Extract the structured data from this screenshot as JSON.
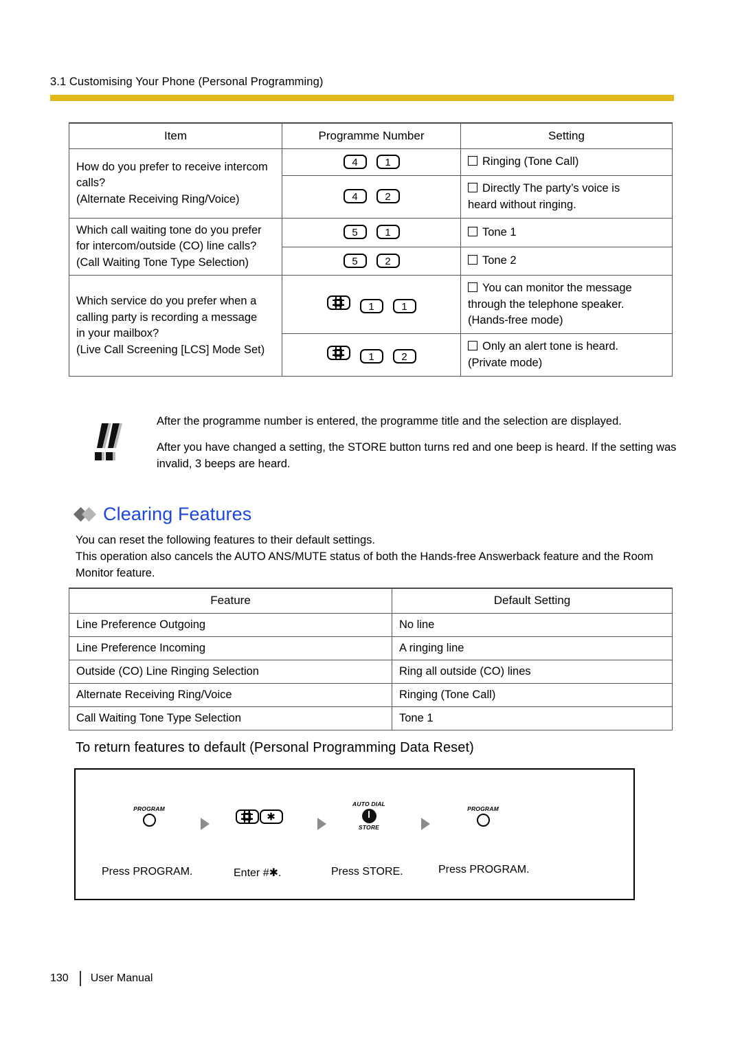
{
  "running_head": "3.1 Customising Your Phone (Personal Programming)",
  "rule_color": "#e0b81a",
  "programme_table": {
    "headers": [
      "Item",
      "Programme Number",
      "Setting"
    ],
    "groups": [
      {
        "item_lines": [
          "How do you prefer to receive intercom",
          "calls?",
          "(Alternate Receiving Ring/Voice)"
        ],
        "rows": [
          {
            "keys": [
              "4",
              "1"
            ],
            "setting_lines": [
              "Ringing (Tone Call)"
            ]
          },
          {
            "keys": [
              "4",
              "2"
            ],
            "setting_lines": [
              "Directly The party’s voice is",
              "heard without ringing."
            ]
          }
        ]
      },
      {
        "item_lines": [
          "Which call waiting tone do you prefer",
          "for intercom/outside (CO) line calls?",
          "(Call Waiting Tone Type Selection)"
        ],
        "rows": [
          {
            "keys": [
              "5",
              "1"
            ],
            "setting_lines": [
              "Tone 1"
            ]
          },
          {
            "keys": [
              "5",
              "2"
            ],
            "setting_lines": [
              "Tone 2"
            ]
          }
        ]
      },
      {
        "item_lines": [
          "Which service do you prefer when a",
          "calling party is recording a message",
          "in your mailbox?",
          "(Live Call Screening [LCS] Mode Set)"
        ],
        "rows": [
          {
            "keys": [
              "#",
              "1",
              "1"
            ],
            "setting_lines": [
              "You can monitor the message",
              "through the telephone speaker.",
              "(Hands-free mode)"
            ]
          },
          {
            "keys": [
              "#",
              "1",
              "2"
            ],
            "setting_lines": [
              "Only an alert tone is heard.",
              "(Private mode)"
            ]
          }
        ]
      }
    ]
  },
  "note": {
    "icon": "double-exclamation-icon",
    "paragraphs": [
      "After the programme number is entered, the programme title and the selection are displayed.",
      "After you have changed a setting, the STORE button turns red and one beep is heard. If the setting was invalid, 3 beeps are heard."
    ]
  },
  "section": {
    "heading": "Clearing Features",
    "heading_color": "#1b47e0",
    "paragraphs": [
      "You can reset the following features to their default settings.",
      "This operation also cancels the AUTO ANS/MUTE status of both the Hands-free Answerback feature and the Room Monitor feature."
    ]
  },
  "defaults_table": {
    "headers": [
      "Feature",
      "Default Setting"
    ],
    "rows": [
      [
        "Line Preference Outgoing",
        "No line"
      ],
      [
        "Line Preference Incoming",
        "A ringing line"
      ],
      [
        "Outside (CO) Line Ringing Selection",
        "Ring all outside (CO) lines"
      ],
      [
        "Alternate Receiving Ring/Voice",
        "Ringing (Tone Call)"
      ],
      [
        "Call Waiting Tone Type Selection",
        "Tone 1"
      ]
    ]
  },
  "procedure": {
    "title": "To return features to default (Personal Programming Data Reset)",
    "steps": [
      {
        "button_top": "PROGRAM",
        "button_bottom": "",
        "icon": "program-button-circle-icon",
        "label": "Press PROGRAM."
      },
      {
        "button_top": "",
        "button_bottom": "",
        "icon": "hash-star-keys-icon",
        "keys": [
          "#",
          "✱"
        ],
        "label": "Enter #✱."
      },
      {
        "button_top": "AUTO DIAL",
        "button_bottom": "STORE",
        "icon": "store-button-icon",
        "label": "Press STORE."
      },
      {
        "button_top": "PROGRAM",
        "button_bottom": "",
        "icon": "program-button-circle-icon",
        "label": "Press PROGRAM."
      }
    ]
  },
  "footer": {
    "page_number": "130",
    "label": "User Manual"
  }
}
